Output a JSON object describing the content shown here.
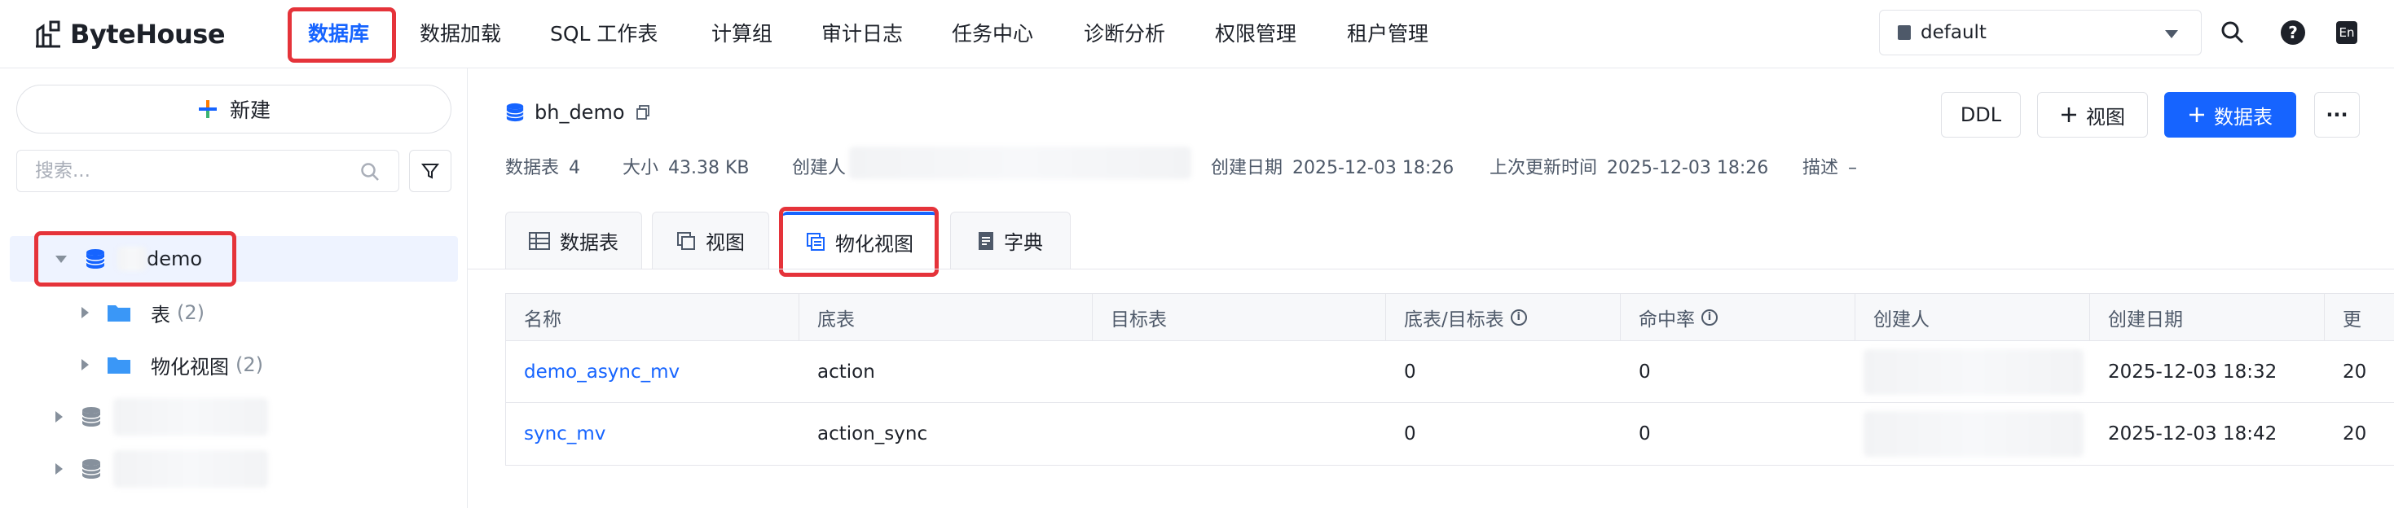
{
  "app": {
    "logo_text": "ByteHouse"
  },
  "nav": {
    "items": [
      {
        "label": "数据库",
        "active": true
      },
      {
        "label": "数据加载"
      },
      {
        "label": "SQL 工作表"
      },
      {
        "label": "计算组"
      },
      {
        "label": "审计日志"
      },
      {
        "label": "任务中心"
      },
      {
        "label": "诊断分析"
      },
      {
        "label": "权限管理"
      },
      {
        "label": "租户管理"
      }
    ],
    "db_select": "default",
    "lang": "En",
    "help": "?"
  },
  "sidebar": {
    "new_button": "新建",
    "search_placeholder": "搜索...",
    "tree": [
      {
        "label": "demo",
        "expanded": true,
        "selected": true
      },
      {
        "label": "表",
        "count": "(2)"
      },
      {
        "label": "物化视图",
        "count": "(2)"
      }
    ]
  },
  "main": {
    "db_name": "bh_demo",
    "meta": {
      "tables_label": "数据表",
      "tables_value": "4",
      "size_label": "大小",
      "size_value": "43.38 KB",
      "creator_label": "创建人",
      "created_label": "创建日期",
      "created_value": "2025-12-03 18:26",
      "updated_label": "上次更新时间",
      "updated_value": "2025-12-03 18:26",
      "desc_label": "描述",
      "desc_value": "–"
    },
    "buttons": {
      "ddl": "DDL",
      "view": "视图",
      "table": "数据表",
      "more": "···"
    },
    "tabs": [
      {
        "label": "数据表"
      },
      {
        "label": "视图"
      },
      {
        "label": "物化视图",
        "active": true
      },
      {
        "label": "字典"
      }
    ],
    "table": {
      "columns": [
        "名称",
        "底表",
        "目标表",
        "底表/目标表",
        "命中率",
        "创建人",
        "创建日期",
        "更"
      ],
      "rows": [
        {
          "name": "demo_async_mv",
          "base": "action",
          "target": "",
          "ratio": "0",
          "hit": "0",
          "creator": "",
          "created": "2025-12-03 18:32",
          "more": "20"
        },
        {
          "name": "sync_mv",
          "base": "action_sync",
          "target": "",
          "ratio": "0",
          "hit": "0",
          "creator": "",
          "created": "2025-12-03 18:42",
          "more": "20"
        }
      ]
    }
  },
  "colors": {
    "accent": "#1664ff",
    "highlight_box": "#e5333a"
  }
}
